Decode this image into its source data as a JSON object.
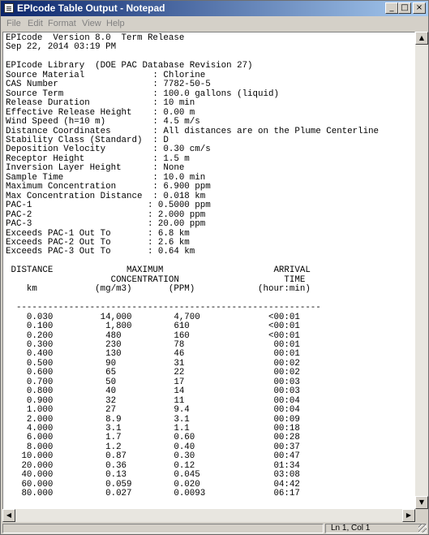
{
  "window": {
    "title": "EPIcode Table Output - Notepad",
    "controls": {
      "minimize": "_",
      "maximize": "□",
      "close": "×"
    }
  },
  "menu": {
    "items": [
      "File",
      "Edit",
      "Format",
      "View",
      "Help"
    ]
  },
  "document": {
    "text": "EPIcode  Version 8.0  Term Release\nSep 22, 2014 03:19 PM\n\nEPIcode Library  (DOE PAC Database Revision 27)\nSource Material             : Chlorine\nCAS Number                  : 7782-50-5\nSource Term                 : 100.0 gallons (liquid)\nRelease Duration            : 10 min\nEffective Release Height    : 0.00 m\nWind Speed (h=10 m)         : 4.5 m/s\nDistance Coordinates        : All distances are on the Plume Centerline\nStability Class (Standard)  : D\nDeposition Velocity         : 0.30 cm/s\nReceptor Height             : 1.5 m\nInversion Layer Height      : None\nSample Time                 : 10.0 min\nMaximum Concentration       : 6.900 ppm\nMax Concentration Distance  : 0.018 km\nPAC-1                      : 0.5000 ppm\nPAC-2                      : 2.000 ppm\nPAC-3                      : 20.00 ppm\nExceeds PAC-1 Out To       : 6.8 km\nExceeds PAC-2 Out To       : 2.6 km\nExceeds PAC-3 Out To       : 0.64 km\n\n DISTANCE              MAXIMUM                     ARRIVAL\n                    CONCENTRATION                    TIME\n    km           (mg/m3)       (PPM)            (hour:min)\n\n  ----------------------------------------------------------\n    0.030         14,000        4,700             <00:01\n    0.100          1,800        610               <00:01\n    0.200          480          160               <00:01\n    0.300          230          78                 00:01\n    0.400          130          46                 00:01\n    0.500          90           31                 00:02\n    0.600          65           22                 00:02\n    0.700          50           17                 00:03\n    0.800          40           14                 00:03\n    0.900          32           11                 00:04\n    1.000          27           9.4                00:04\n    2.000          8.9          3.1                00:09\n    4.000          3.1          1.1                00:18\n    6.000          1.7          0.60               00:28\n    8.000          1.2          0.40               00:37\n   10.000          0.87         0.30               00:47\n   20.000          0.36         0.12               01:34\n   40.000          0.13         0.045              03:08\n   60.000          0.059        0.020              04:42\n   80.000          0.027        0.0093             06:17"
  },
  "scrollbars": {
    "up_arrow": "▲",
    "down_arrow": "▼",
    "left_arrow": "◀",
    "right_arrow": "▶"
  },
  "status": {
    "position": "Ln 1, Col 1"
  }
}
